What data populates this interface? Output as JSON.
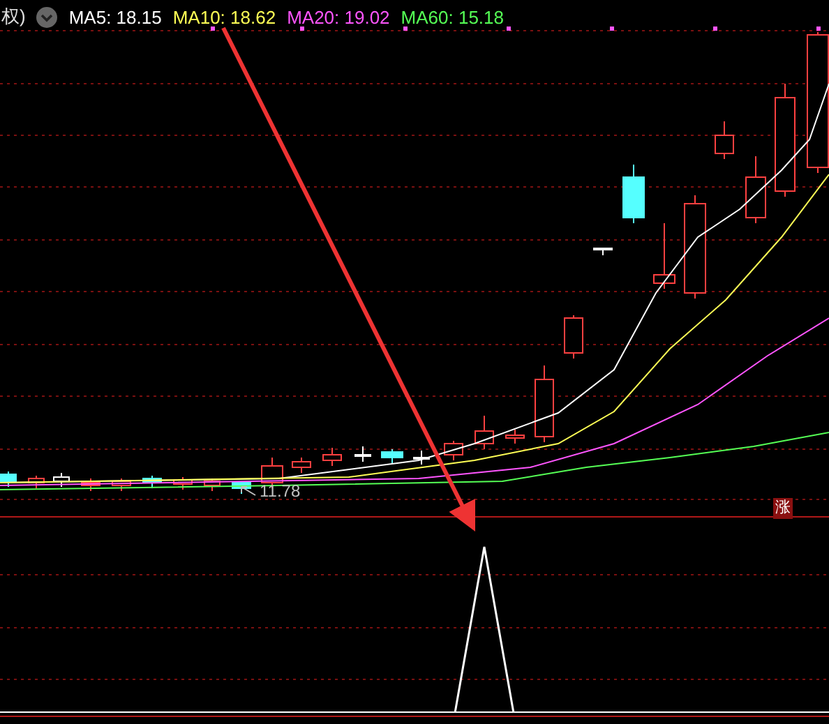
{
  "header": {
    "title_fragment": "权)",
    "indicators": [
      {
        "label": "MA5: 18.15",
        "color": "#ffffff"
      },
      {
        "label": "MA10: 18.62",
        "color": "#ffff55"
      },
      {
        "label": "MA20: 19.02",
        "color": "#ff55ff"
      },
      {
        "label": "MA60: 15.18",
        "color": "#55ff55"
      }
    ]
  },
  "low_price_label": "11.78",
  "badge": "涨"
}
